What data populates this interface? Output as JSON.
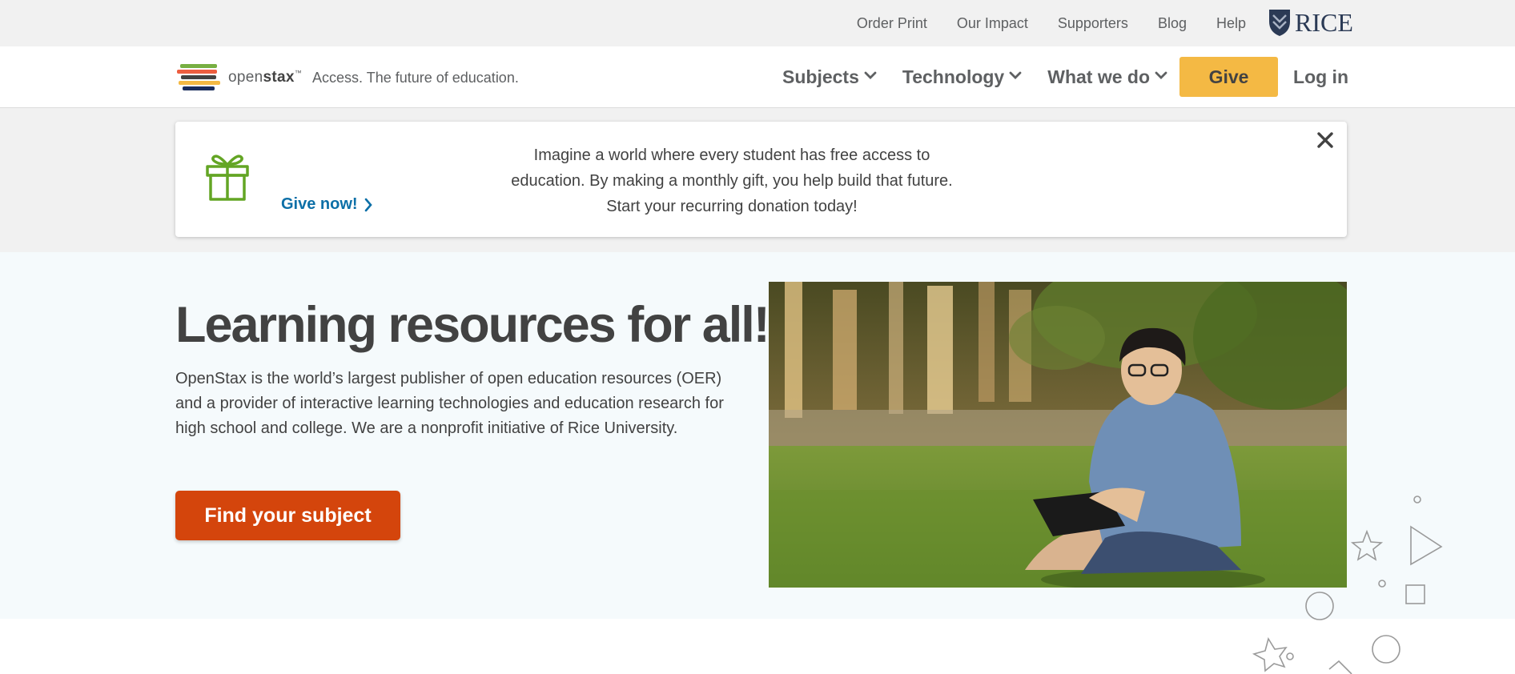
{
  "utility_bar": {
    "links": [
      "Order Print",
      "Our Impact",
      "Supporters",
      "Blog",
      "Help"
    ],
    "rice_logo_text": "RICE"
  },
  "header": {
    "brand_name_light": "open",
    "brand_name_bold": "stax",
    "brand_tm": "™",
    "tagline": "Access. The future of education.",
    "nav": [
      {
        "label": "Subjects",
        "icon": "chevron-down-icon"
      },
      {
        "label": "Technology",
        "icon": "chevron-down-icon"
      },
      {
        "label": "What we do",
        "icon": "chevron-down-icon"
      }
    ],
    "give_label": "Give",
    "login_label": "Log in"
  },
  "banner": {
    "icon": "gift-icon",
    "give_now_label": "Give now!",
    "message": "Imagine a world where every student has free access to education. By making a monthly gift, you help build that future. Start your recurring donation today!",
    "close_icon": "close-icon"
  },
  "hero": {
    "title": "Learning resources for all!",
    "description": "OpenStax is the world’s largest publisher of open education resources (OER) and a provider of interactive learning technologies and education research for high school and college. We are a nonprofit initiative of Rice University.",
    "cta_label": "Find your subject",
    "photo": "student-with-tablet-photo"
  },
  "colors": {
    "give_button": "#f4b944",
    "cta_button": "#d4450c",
    "link_blue": "#0c6fa7",
    "gift_green": "#63a524",
    "hero_background": "#f5fafc"
  }
}
